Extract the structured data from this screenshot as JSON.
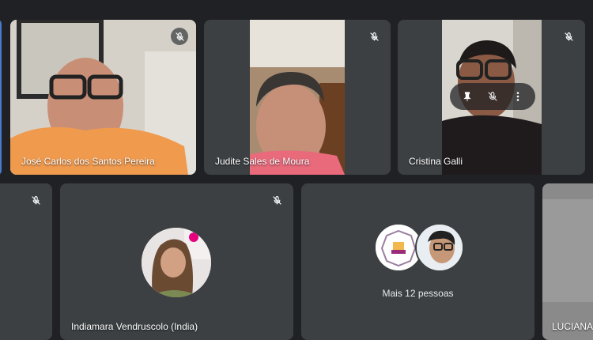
{
  "participants": [
    {
      "name": "José Carlos dos Santos Pereira",
      "muted": true
    },
    {
      "name": "Judite Sales de Moura",
      "muted": true
    },
    {
      "name": "Cristina Galli",
      "muted": true
    },
    {
      "name": "",
      "muted": true
    },
    {
      "name": "Indiamara Vendruscolo (India)",
      "muted": true
    },
    {
      "name": "LUCIANA",
      "muted": false
    }
  ],
  "overflow_tile": {
    "label": "Mais 12 pessoas"
  },
  "icons": {
    "mute": "mic-off-icon",
    "pin": "pin-icon",
    "hide": "mic-off-icon",
    "more": "more-vert-icon"
  },
  "colors": {
    "background": "#202124",
    "tile": "#3c4043"
  }
}
